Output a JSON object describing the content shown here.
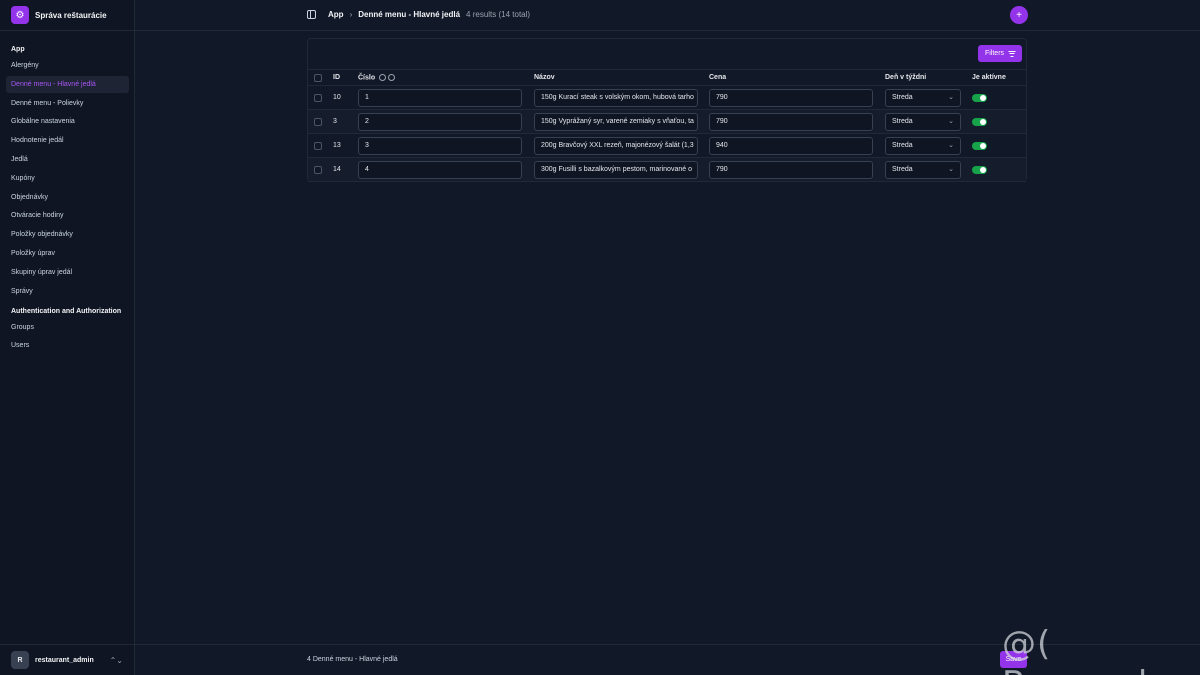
{
  "app": {
    "title": "Správa reštaurácie",
    "logo_icon": "gear-icon"
  },
  "sidebar": {
    "sections": [
      {
        "title": "App",
        "items": [
          {
            "label": "Alergény",
            "active": false
          },
          {
            "label": "Denné menu - Hlavné jedlá",
            "active": true
          },
          {
            "label": "Denné menu - Polievky",
            "active": false
          },
          {
            "label": "Globálne nastavenia",
            "active": false
          },
          {
            "label": "Hodnotenie jedál",
            "active": false
          },
          {
            "label": "Jedlá",
            "active": false
          },
          {
            "label": "Kupóny",
            "active": false
          },
          {
            "label": "Objednávky",
            "active": false
          },
          {
            "label": "Otváracie hodiny",
            "active": false
          },
          {
            "label": "Položky objednávky",
            "active": false
          },
          {
            "label": "Položky úprav",
            "active": false
          },
          {
            "label": "Skupiny úprav jedál",
            "active": false
          },
          {
            "label": "Správy",
            "active": false
          }
        ]
      },
      {
        "title": "Authentication and Authorization",
        "items": [
          {
            "label": "Groups",
            "active": false
          },
          {
            "label": "Users",
            "active": false
          }
        ]
      }
    ],
    "user": {
      "initial": "R",
      "name": "restaurant_admin",
      "toggle_glyph": "⌃⌄"
    }
  },
  "header": {
    "breadcrumb_app": "App",
    "breadcrumb_chevron": "›",
    "page_title": "Denné menu - Hlavné jedlá",
    "results": "4 results (14 total)",
    "add_glyph": "+"
  },
  "toolbar": {
    "filters_label": "Filters"
  },
  "table": {
    "columns": [
      "ID",
      "Číslo",
      "Názov",
      "Cena",
      "Deň v týždni",
      "Je aktívne"
    ],
    "select_chevron": "⌄",
    "rows": [
      {
        "id": "10",
        "cislo": "1",
        "nazov": "150g Kurací steak s volským okom, hubová tarho",
        "cena": "790",
        "den": "Streda",
        "aktivne": true
      },
      {
        "id": "3",
        "cislo": "2",
        "nazov": "150g Vyprážaný syr, varené zemiaky s vňaťou, ta",
        "cena": "790",
        "den": "Streda",
        "aktivne": true
      },
      {
        "id": "13",
        "cislo": "3",
        "nazov": "200g Bravčový XXL rezeň, majonézový šalát (1,3",
        "cena": "940",
        "den": "Streda",
        "aktivne": true
      },
      {
        "id": "14",
        "cislo": "4",
        "nazov": "300g Fusilli s bazalkovým pestom, marinované o",
        "cena": "790",
        "den": "Streda",
        "aktivne": true
      }
    ]
  },
  "footer": {
    "count_label": "4 Denné menu - Hlavné jedlá",
    "save_label": "Save"
  },
  "watermark": "@( Bazos.sk",
  "colors": {
    "accent": "#9333ea",
    "active_text": "#a855f7",
    "toggle_on": "#16a34a",
    "background": "#111827"
  }
}
